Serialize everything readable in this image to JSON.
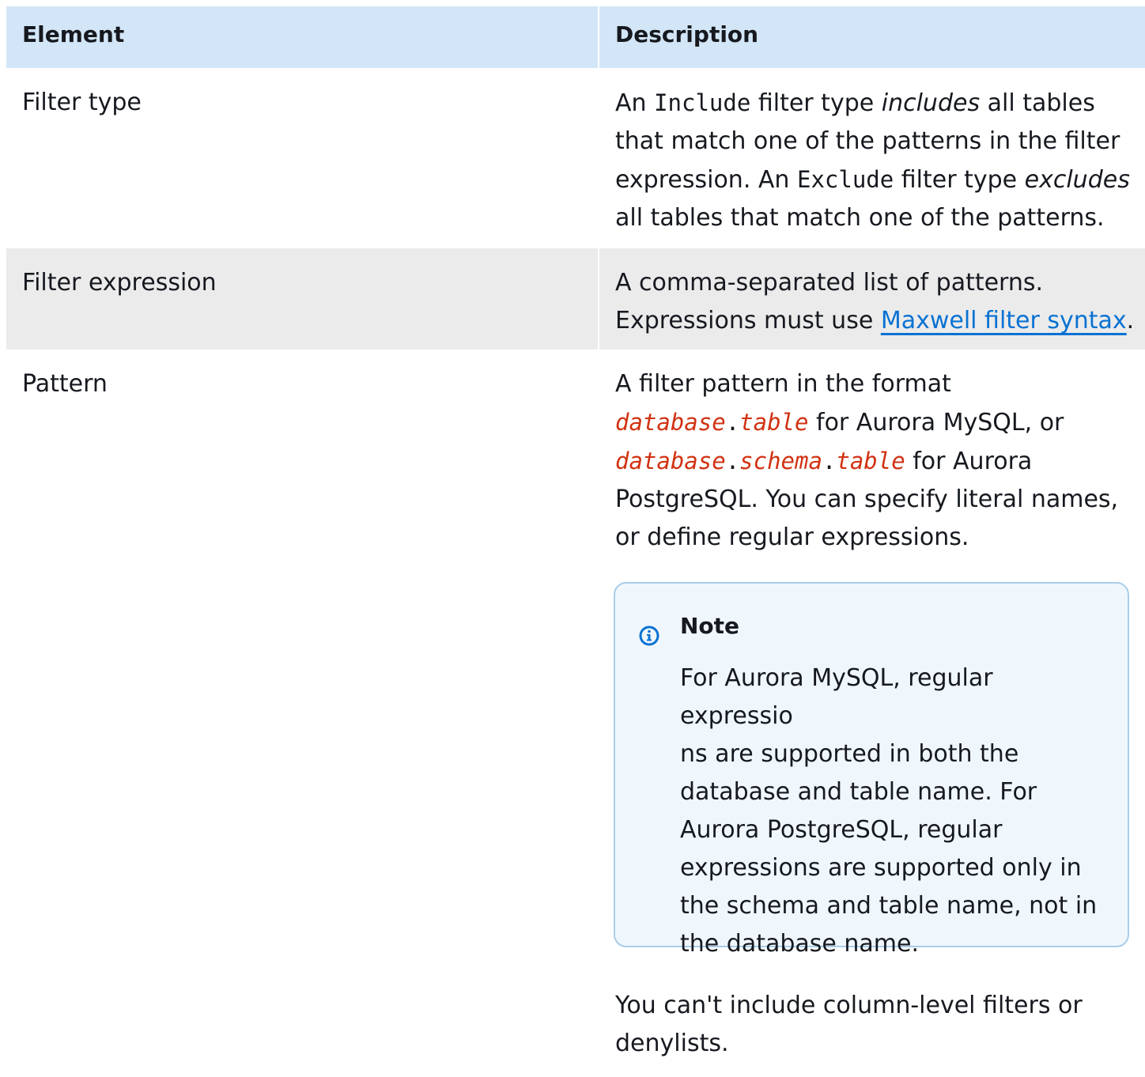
{
  "table": {
    "headers": {
      "element": "Element",
      "description": "Description"
    },
    "rows": [
      {
        "element": "Filter type",
        "description": {
          "an": "An",
          "include_code": "Include",
          "filter_type": "filter type",
          "includes_em": "includes",
          "text1": "all tables that match one of the patterns in the filter expression. An",
          "exclude_code": "Exclude",
          "filter_type2": "filter type",
          "excludes_em": "excludes",
          "text2": "all tables that match one of the patterns."
        }
      },
      {
        "element": "Filter expression",
        "description": {
          "text1": "A comma-separated list of patterns. Expressions must use",
          "link": "Maxwell filter syntax",
          "period": "."
        }
      },
      {
        "element": "Pattern",
        "description": {
          "text1": "A filter pattern in the format",
          "var_database": "database",
          "dot": ".",
          "var_table": "table",
          "text2": "for Aurora MySQL, or",
          "var_database2": "database",
          "dot2": ".",
          "var_schema": "schema",
          "dot3": ".",
          "var_table2": "table",
          "text3": "for Aurora PostgreSQL. You can specify literal names, or define regular expressions.",
          "note_title": "Note",
          "note_lines": [
            "For Aurora MySQL, regular expressio",
            "ns are supported in both the",
            "database and table name. For",
            "Aurora PostgreSQL, regular",
            "expressions are supported only in",
            "the schema and table name, not in",
            "the database name."
          ],
          "after_note": "You can't include column-level filters or denylists."
        }
      }
    ]
  },
  "colors": {
    "header_bg": "#d3e6f7",
    "striped_row_bg": "#ebebeb",
    "link": "#0972d3",
    "variable": "#d13212",
    "note_border": "#a9cde9",
    "note_bg": "#f0f7fc",
    "info_icon": "#0972d3"
  },
  "icons": {
    "note": "info-icon"
  }
}
